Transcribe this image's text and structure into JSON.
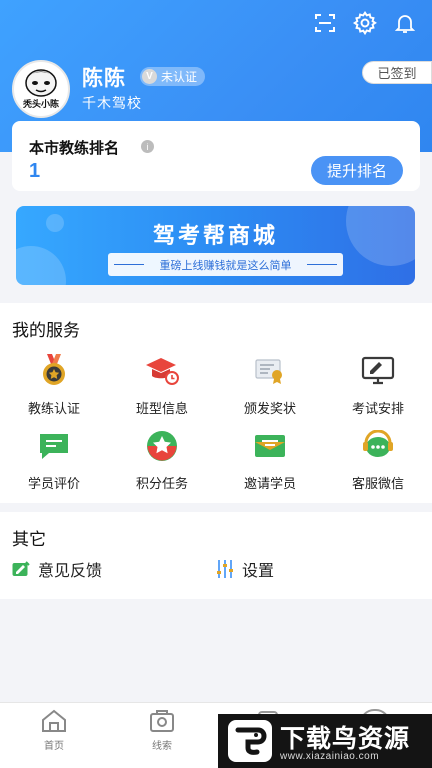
{
  "profile": {
    "name": "陈陈",
    "verify_status": "未认证",
    "verify_mark": "V",
    "school": "千木驾校",
    "avatar_caption": "秃头小陈",
    "signed_in_label": "已签到"
  },
  "top_icons": [
    "scan-icon",
    "gear-icon",
    "bell-icon"
  ],
  "ranking": {
    "title": "本市教练排名",
    "info_mark": "i",
    "value": "1",
    "button_label": "提升排名"
  },
  "mall_banner": {
    "title": "驾考帮商城",
    "subtitle": "重磅上线赚钱就是这么简单"
  },
  "services": {
    "title": "我的服务",
    "items": [
      {
        "label": "教练认证",
        "icon": "medal-icon"
      },
      {
        "label": "班型信息",
        "icon": "grad-cap-icon"
      },
      {
        "label": "颁发奖状",
        "icon": "certificate-icon"
      },
      {
        "label": "考试安排",
        "icon": "monitor-icon"
      },
      {
        "label": "学员评价",
        "icon": "comment-icon"
      },
      {
        "label": "积分任务",
        "icon": "star-badge-icon"
      },
      {
        "label": "邀请学员",
        "icon": "envelope-icon"
      },
      {
        "label": "客服微信",
        "icon": "chat-bubble-icon"
      }
    ]
  },
  "others": {
    "title": "其它",
    "items": [
      {
        "label": "意见反馈",
        "icon": "feedback-icon"
      },
      {
        "label": "设置",
        "icon": "sliders-icon"
      }
    ]
  },
  "tabbar": {
    "items": [
      {
        "label": "首页",
        "icon": "home-icon"
      },
      {
        "label": "线索",
        "icon": "clue-icon"
      }
    ]
  },
  "watermark": {
    "title": "下载鸟资源",
    "url": "www.xiazainiao.com"
  },
  "colors": {
    "header_blue": "#3a8ff5",
    "accent_blue": "#4a93f5",
    "service_red": "#e8453c",
    "service_green": "#3cb35a",
    "service_gold": "#e0a526"
  }
}
